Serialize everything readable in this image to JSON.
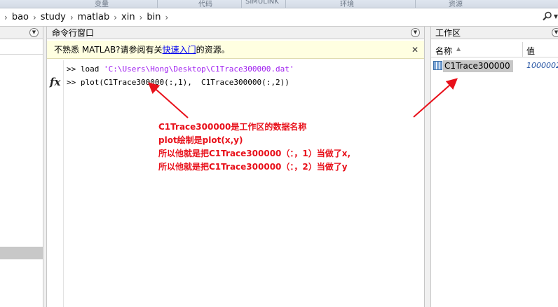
{
  "ribbon": {
    "tabs": [
      "变量",
      "代码",
      "SIMULINK",
      "环境",
      "资源"
    ]
  },
  "address": {
    "crumbs": [
      "bao",
      "study",
      "matlab",
      "xin",
      "bin"
    ]
  },
  "command_window": {
    "title": "命令行窗口",
    "notice_prefix": "不熟悉 MATLAB?请参阅有关",
    "notice_link": "快速入门",
    "notice_suffix": "的资源。",
    "lines": [
      {
        "prompt": ">>",
        "cmd": "load ",
        "str": "'C:\\Users\\Hong\\Desktop\\C1Trace300000.dat'"
      },
      {
        "prompt": ">>",
        "cmd": "plot(C1Trace300000(:,1),  C1Trace300000(:,2))",
        "str": ""
      }
    ],
    "fx": "fx"
  },
  "workspace": {
    "title": "工作区",
    "col_name": "名称",
    "col_value": "值",
    "variables": [
      {
        "name": "C1Trace300000",
        "value": "1000002"
      }
    ]
  },
  "annotation": {
    "lines": [
      "C1Trace300000是工作区的数据名称",
      "plot绘制是plot(x,y)",
      "所以他就是把C1Trace300000（：，1）当做了x,",
      "所以他就是把C1Trace300000（：，2）当做了y"
    ]
  },
  "colors": {
    "annotation": "#e8101a",
    "notice_bg": "#ffffe1",
    "selected_row": "#c7c7c7"
  }
}
